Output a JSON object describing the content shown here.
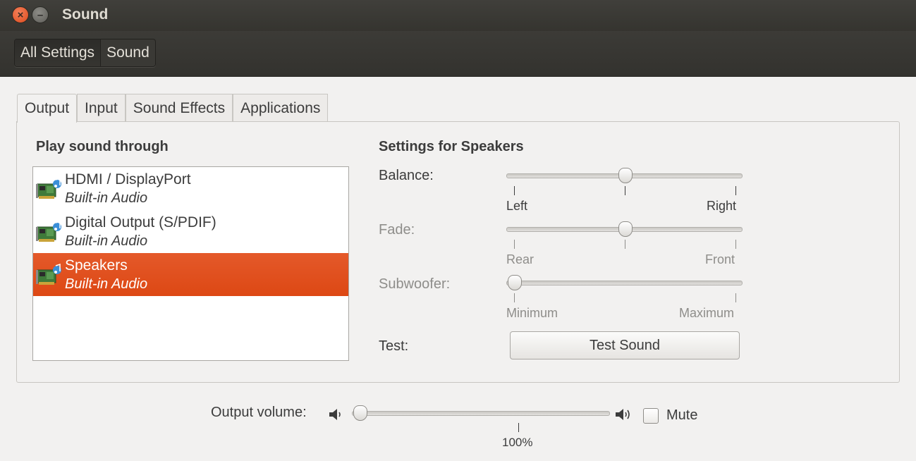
{
  "window": {
    "title": "Sound"
  },
  "toolbar": {
    "crumbs": [
      "All Settings",
      "Sound"
    ]
  },
  "tabs": [
    "Output",
    "Input",
    "Sound Effects",
    "Applications"
  ],
  "output": {
    "play_through_title": "Play sound through",
    "devices": [
      {
        "name": "HDMI / DisplayPort",
        "sub": "Built-in Audio",
        "selected": false
      },
      {
        "name": "Digital Output (S/PDIF)",
        "sub": "Built-in Audio",
        "selected": false
      },
      {
        "name": "Speakers",
        "sub": "Built-in Audio",
        "selected": true
      }
    ],
    "settings_title": "Settings for Speakers",
    "balance": {
      "label": "Balance:",
      "left": "Left",
      "right": "Right",
      "value": 0.5
    },
    "fade": {
      "label": "Fade:",
      "left": "Rear",
      "right": "Front",
      "value": 0.5
    },
    "subwoofer": {
      "label": "Subwoofer:",
      "left": "Minimum",
      "right": "Maximum",
      "value": 0.0
    },
    "test": {
      "label": "Test:",
      "button": "Test Sound"
    }
  },
  "volume": {
    "label": "Output volume:",
    "value_text": "100%",
    "value": 0.0,
    "mute_label": "Mute",
    "muted": false
  },
  "colors": {
    "accent": "#dd4814",
    "titlebar": "#3c3b37"
  },
  "icons": {
    "close": "close-icon",
    "minimize": "minimize-icon",
    "sound_card": "sound-card-icon",
    "volume_low": "speaker-low-icon",
    "volume_high": "speaker-high-icon"
  }
}
